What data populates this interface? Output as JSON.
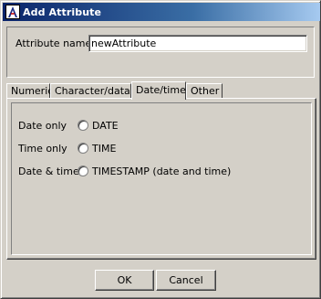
{
  "window": {
    "title": "Add Attribute",
    "icon": "app-logo-icon"
  },
  "name_field": {
    "label": "Attribute name:",
    "value": "newAttribute"
  },
  "tabs": [
    {
      "label": "Numeric",
      "active": false
    },
    {
      "label": "Character/data",
      "active": false
    },
    {
      "label": "Date/time",
      "active": true
    },
    {
      "label": "Other",
      "active": false
    }
  ],
  "datetime_options": [
    {
      "label": "Date only",
      "option": "DATE",
      "selected": false
    },
    {
      "label": "Time only",
      "option": "TIME",
      "selected": false
    },
    {
      "label": "Date & time",
      "option": "TIMESTAMP (date and time)",
      "selected": false
    }
  ],
  "buttons": {
    "ok": "OK",
    "cancel": "Cancel"
  }
}
